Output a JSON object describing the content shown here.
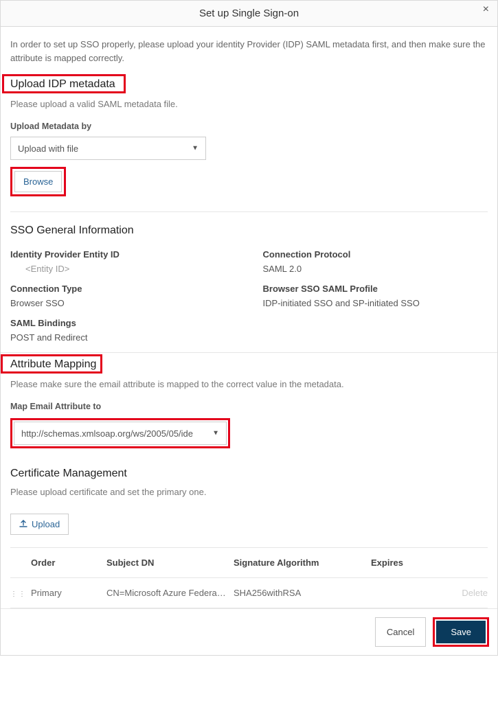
{
  "dialog": {
    "title": "Set up Single Sign-on",
    "close_glyph": "×"
  },
  "intro": "In order to set up SSO properly, please upload your identity Provider (IDP) SAML metadata first, and then make sure the attribute is mapped correctly.",
  "upload_section": {
    "heading": "Upload IDP metadata",
    "subtext": "Please upload a valid SAML metadata file.",
    "method_label": "Upload Metadata by",
    "method_selected": "Upload with file",
    "browse_label": "Browse"
  },
  "general_info": {
    "heading": "SSO General Information",
    "entity_id_label": "Identity Provider Entity ID",
    "entity_id_value": "<Entity ID>",
    "protocol_label": "Connection Protocol",
    "protocol_value": "SAML 2.0",
    "conn_type_label": "Connection Type",
    "conn_type_value": "Browser SSO",
    "profile_label": "Browser SSO SAML Profile",
    "profile_value": "IDP-initiated SSO and SP-initiated SSO",
    "bindings_label": "SAML Bindings",
    "bindings_value": "POST and Redirect"
  },
  "attr_mapping": {
    "heading": "Attribute Mapping",
    "subtext": "Please make sure the email attribute is mapped to the correct value in the metadata.",
    "map_label": "Map Email Attribute to",
    "map_selected": "http://schemas.xmlsoap.org/ws/2005/05/ide"
  },
  "cert": {
    "heading": "Certificate Management",
    "subtext": "Please upload certificate and set the primary one.",
    "upload_label": "Upload",
    "columns": {
      "order": "Order",
      "subject": "Subject DN",
      "alg": "Signature Algorithm",
      "expires": "Expires"
    },
    "row": {
      "order": "Primary",
      "subject": "CN=Microsoft Azure Federa…",
      "alg": "SHA256withRSA",
      "expires": "",
      "delete": "Delete"
    }
  },
  "footer": {
    "cancel": "Cancel",
    "save": "Save"
  }
}
